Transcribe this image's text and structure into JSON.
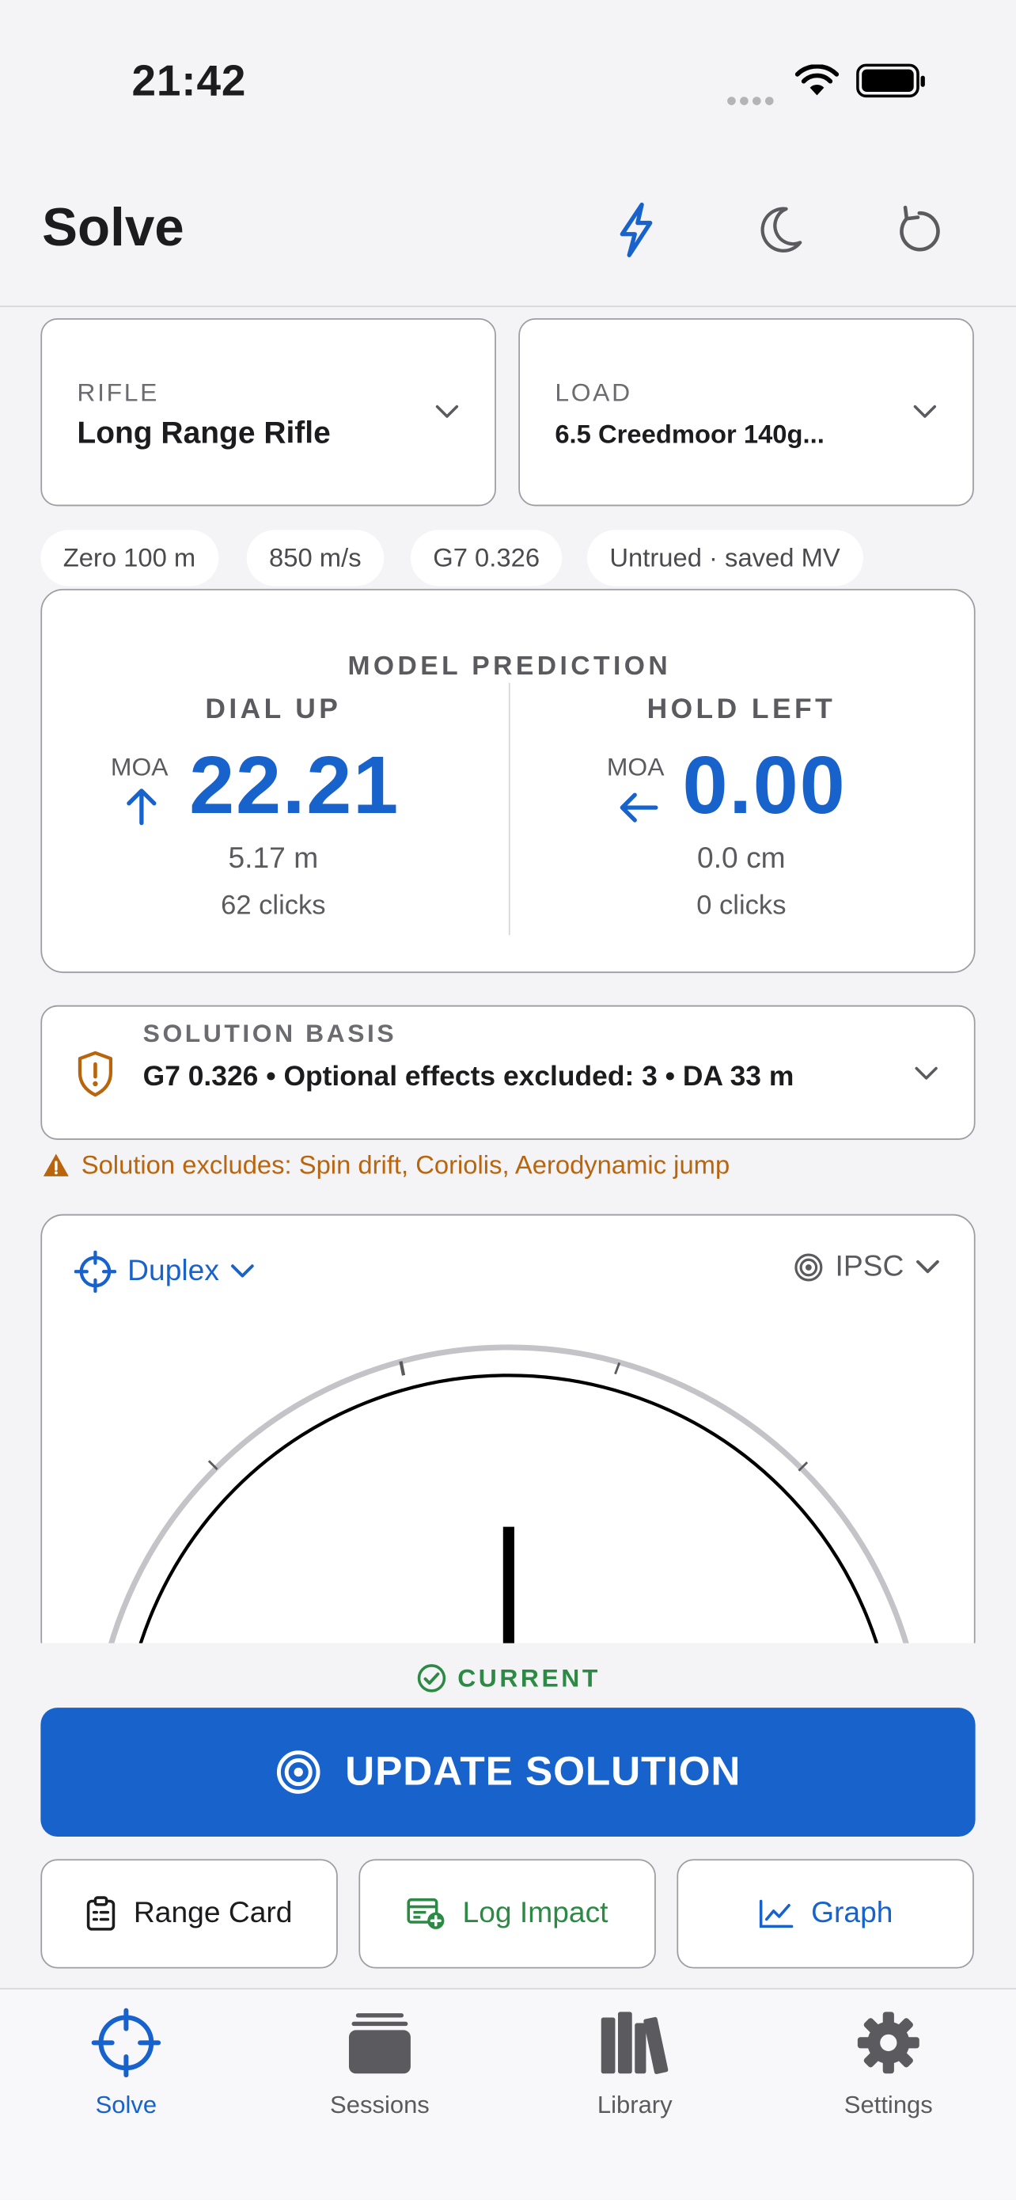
{
  "status_bar": {
    "time": "21:42"
  },
  "header": {
    "title": "Solve"
  },
  "selectors": {
    "rifle": {
      "label": "RIFLE",
      "value": "Long Range Rifle"
    },
    "load": {
      "label": "LOAD",
      "value": "6.5 Creedmoor 140g..."
    }
  },
  "chips": [
    "Zero 100 m",
    "850 m/s",
    "G7 0.326",
    "Untrued · saved MV"
  ],
  "prediction": {
    "title": "MODEL PREDICTION",
    "dial_up": {
      "title": "DIAL UP",
      "unit": "MOA",
      "value": "22.21",
      "linear": "5.17 m",
      "clicks": "62 clicks"
    },
    "hold_left": {
      "title": "HOLD LEFT",
      "unit": "MOA",
      "value": "0.00",
      "linear": "0.0 cm",
      "clicks": "0 clicks"
    }
  },
  "solution_basis": {
    "label": "SOLUTION BASIS",
    "text": "G7 0.326 • Optional effects excluded: 3 • DA 33 m"
  },
  "warning": "Solution excludes: Spin drift, Coriolis, Aerodynamic jump",
  "reticle": {
    "reticle_name": "Duplex",
    "target_name": "IPSC"
  },
  "solution_status": "CURRENT",
  "update_button": "UPDATE SOLUTION",
  "actions": {
    "range_card": "Range Card",
    "log_impact": "Log Impact",
    "graph": "Graph"
  },
  "tabs": [
    {
      "label": "Solve",
      "icon": "crosshair-icon",
      "active": true
    },
    {
      "label": "Sessions",
      "icon": "sessions-stack-icon",
      "active": false
    },
    {
      "label": "Library",
      "icon": "books-icon",
      "active": false
    },
    {
      "label": "Settings",
      "icon": "gear-icon",
      "active": false
    }
  ],
  "colors": {
    "accent": "#1862cc",
    "warning": "#b8650d",
    "success": "#2d8a45",
    "background": "#f4f4f6"
  }
}
